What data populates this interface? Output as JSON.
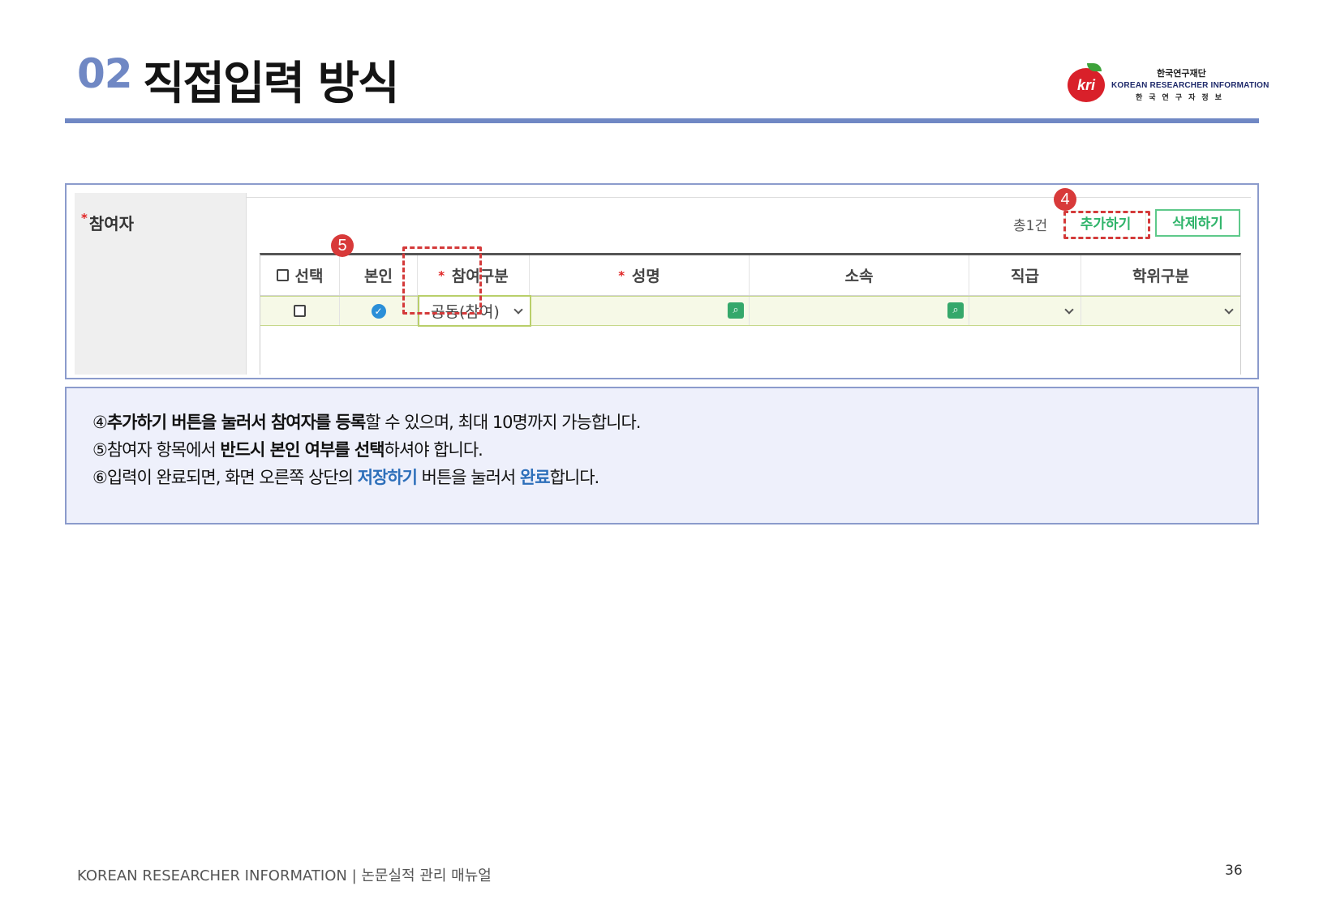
{
  "header": {
    "section_number": "02",
    "title": "직접입력 방식"
  },
  "logo": {
    "mark": "kri",
    "org_korean": "한국연구재단",
    "org_english": "KOREAN RESEARCHER INFORMATION",
    "org_korean_spaced": "한국연구자정보",
    "colors": {
      "apple": "#d9202a",
      "leaf": "#3da23a",
      "text": "#1f2a6b"
    }
  },
  "panel": {
    "field_label": "참여자",
    "required_mark": "*",
    "count_label": "총1건",
    "add_button": "추가하기",
    "delete_button": "삭제하기",
    "badge_add": "4",
    "badge_self": "5",
    "table": {
      "columns": [
        {
          "label": "선택",
          "required": false,
          "checkbox": true
        },
        {
          "label": "본인",
          "required": false
        },
        {
          "label": "참여구분",
          "required": true
        },
        {
          "label": "성명",
          "required": true
        },
        {
          "label": "소속",
          "required": false
        },
        {
          "label": "직급",
          "required": false
        },
        {
          "label": "학위구분",
          "required": false
        }
      ],
      "row": {
        "selected": false,
        "is_self": true,
        "participation_type": "공동(참여)",
        "name": "",
        "affiliation": "",
        "position": "",
        "degree": ""
      }
    },
    "colors": {
      "accent_green": "#2fb46a",
      "highlight_red": "#d43a3a",
      "row_bg": "#f6f9e7"
    }
  },
  "description": {
    "line1": {
      "num": "④",
      "bold1": "추가하기 버튼을 눌러서 참여자를 등록",
      "rest": "할 수 있으며, 최대 10명까지 가능합니다."
    },
    "line2": {
      "num": "⑤",
      "pre": "참여자 항목에서 ",
      "bold1": "반드시 본인 여부를 선택",
      "rest": "하셔야 합니다."
    },
    "line3": {
      "num": "⑥",
      "pre": "입력이 완료되면, 화면 오른쪽 상단의 ",
      "blue1": "저장하기",
      "mid": " 버튼을 눌러서 ",
      "blue2": "완료",
      "rest": "합니다."
    }
  },
  "footer": {
    "left": "KOREAN RESEARCHER INFORMATION | 논문실적 관리 매뉴얼",
    "page": "36"
  }
}
